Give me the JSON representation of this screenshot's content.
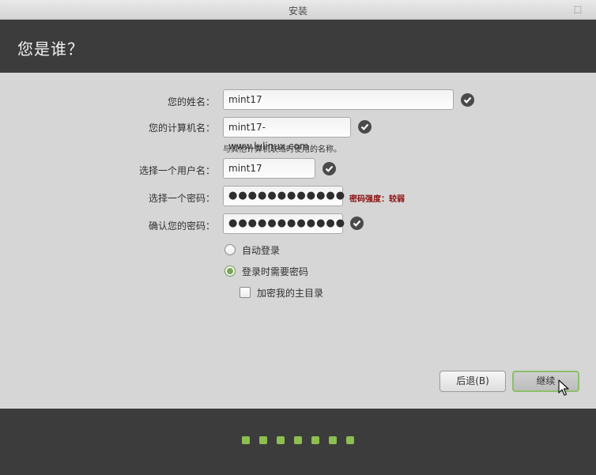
{
  "window": {
    "title": "安装",
    "restore_glyph": "⬚"
  },
  "header": {
    "title": "您是谁？"
  },
  "form": {
    "name": {
      "label": "您的姓名：",
      "value": "mint17"
    },
    "computer": {
      "label": "您的计算机名：",
      "value": "mint17-www.lulinux.com",
      "hint": "与其他计算机联络时使用的名称。"
    },
    "username": {
      "label": "选择一个用户名：",
      "value": "mint17"
    },
    "password": {
      "label": "选择一个密码：",
      "value": "●●●●●●●●●●●●",
      "strength": "密码强度：较弱"
    },
    "confirm": {
      "label": "确认您的密码：",
      "value": "●●●●●●●●●●●●"
    },
    "options": {
      "auto_login": {
        "label": "自动登录",
        "selected": false
      },
      "require_password": {
        "label": "登录时需要密码",
        "selected": true
      },
      "encrypt_home": {
        "label": "加密我的主目录",
        "checked": false
      }
    }
  },
  "buttons": {
    "back": "后退(B)",
    "continue": "继续"
  },
  "progress": {
    "steps": 7
  },
  "colors": {
    "accent": "#8cbf4f",
    "header_bg": "#3c3c3c",
    "warning": "#8b0d0d"
  },
  "icons": {
    "valid": "check-circle-icon",
    "cursor": "mouse-pointer-icon",
    "window": "restore-window-icon"
  }
}
